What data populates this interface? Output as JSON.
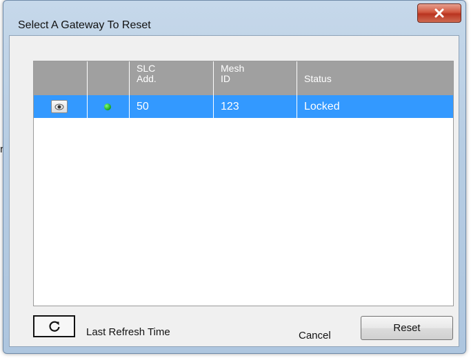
{
  "background": {
    "partial_text": "r"
  },
  "window": {
    "title": "Select A Gateway To Reset"
  },
  "grid": {
    "headers": [
      "",
      "",
      "SLC\nAdd.",
      "Mesh\nID",
      "Status"
    ],
    "rows": [
      {
        "view_icon": "eye-icon",
        "indicator_color": "#22cc22",
        "slc_add": "50",
        "mesh_id": "123",
        "status": "Locked"
      }
    ],
    "selection_color": "#3399ff"
  },
  "footer": {
    "refresh_icon": "refresh-icon",
    "refresh_label": "Last Refresh Time",
    "cancel_label": "Cancel",
    "reset_label": "Reset"
  }
}
